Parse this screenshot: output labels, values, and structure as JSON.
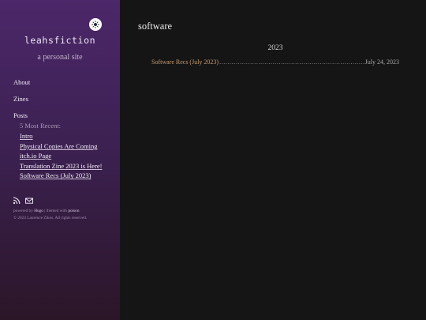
{
  "site": {
    "title": "leahsfiction",
    "subtitle": "a personal site"
  },
  "nav": {
    "about": "About",
    "zines": "Zines",
    "posts": "Posts",
    "recent_label": "5 Most Recent:",
    "recent": [
      "Intro",
      "Physical Copies Are Coming",
      "itch.io Page",
      "Translation Zine 2023 is Here!",
      "Software Recs (July 2023)"
    ]
  },
  "footer": {
    "powered_prefix": "powered by",
    "hugo": "Hugo",
    "themed_prefix": "| themed with",
    "poison": "poison",
    "copyright": "© 2024 Laurence Zikes. All rights reserved."
  },
  "main": {
    "title": "software",
    "year": "2023",
    "post_title": "Software Recs (July 2023)",
    "post_leader": "............................................................................................................",
    "post_date": "July 24, 2023"
  },
  "colors": {
    "sidebar_top": "#4c2769",
    "sidebar_bottom": "#2b1628",
    "main_bg": "#151515",
    "post_link": "#c79a6e"
  },
  "icons": {
    "theme_toggle": "sun-icon",
    "rss": "rss-icon",
    "email": "email-icon"
  }
}
